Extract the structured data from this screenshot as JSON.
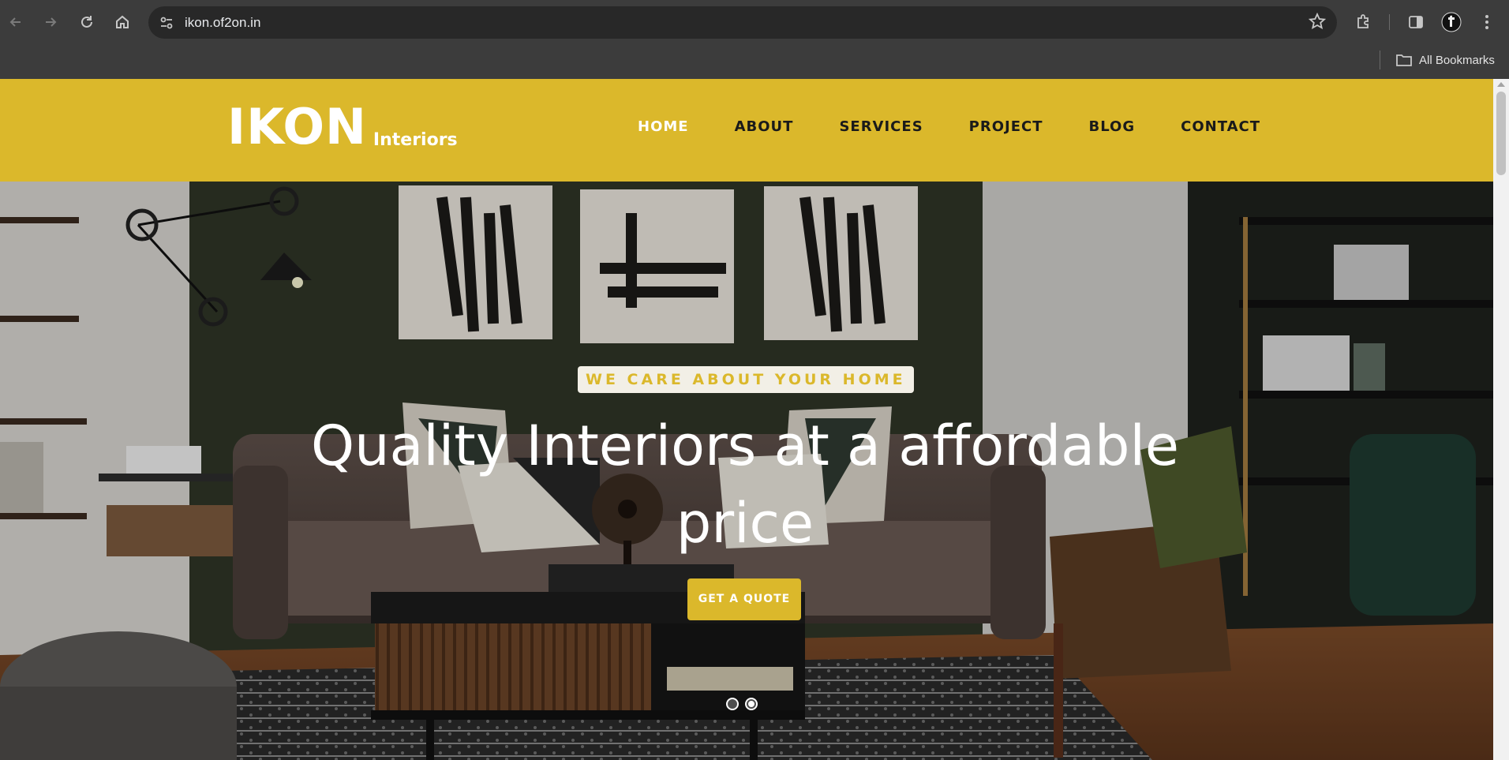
{
  "browser": {
    "url": "ikon.of2on.in",
    "bookmarks_label": "All Bookmarks",
    "icons": [
      "back-icon",
      "forward-icon",
      "reload-icon",
      "home-icon",
      "site-settings-icon",
      "bookmark-star-icon",
      "extensions-icon",
      "side-panel-icon",
      "profile-avatar",
      "menu-icon",
      "folder-icon"
    ]
  },
  "site": {
    "logo": {
      "main": "IKON",
      "sub": "Interiors"
    },
    "nav": [
      "HOME",
      "ABOUT",
      "SERVICES",
      "PROJECT",
      "BLOG",
      "CONTACT"
    ],
    "active_nav": "HOME",
    "colors": {
      "brand": "#dbb82b",
      "nav_text": "#1a1a1a",
      "active_nav": "#ffffff"
    }
  },
  "hero": {
    "tagline": "WE CARE ABOUT YOUR HOME",
    "headline_line1": "Quality Interiors at a affordable",
    "headline_line2": "price",
    "cta_label": "GET A QUOTE",
    "slider": {
      "slides": 2,
      "active": 2
    }
  }
}
